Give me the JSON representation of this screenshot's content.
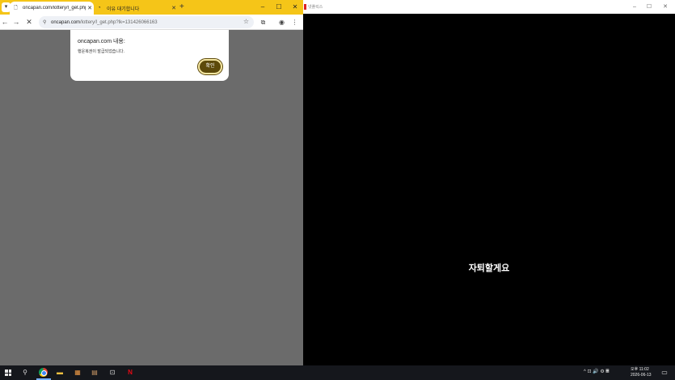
{
  "browser": {
    "tabs": [
      {
        "title": "oncapan.com/lottery/l_get.php",
        "active": true
      },
      {
        "title": "이유 대기합니다",
        "active": false
      }
    ],
    "new_tab_label": "+",
    "url_host": "oncapan.com",
    "url_path": "/lottery/l_get.php?lk=131426066163",
    "window_controls": {
      "minimize": "–",
      "maximize": "☐",
      "close": "✕"
    }
  },
  "dialog": {
    "title": "oncapan.com 내용:",
    "message": "행운복권이 발급되었습니다.",
    "ok_label": "확인"
  },
  "player": {
    "window_title": "넷플릭스",
    "caption": "자퇴할게요"
  },
  "taskbar": {
    "clock_time": "오후 11:02",
    "clock_date": "2026-06-13",
    "tray_text": "^ ⊡ 🔊 ⚙ 𝄜"
  },
  "colors": {
    "tabstrip": "#f5c518",
    "page_bg": "#6b6b6b",
    "ok_button": "#5d4a0a",
    "netflix_red": "#e50914"
  }
}
